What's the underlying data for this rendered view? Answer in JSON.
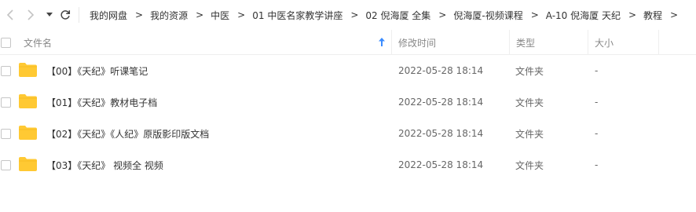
{
  "navigation": {
    "back_icon": "chevron-left-icon",
    "forward_icon": "chevron-right-icon",
    "dropdown_icon": "caret-down-icon",
    "refresh_icon": "refresh-icon"
  },
  "breadcrumb": {
    "separator": ">",
    "items": [
      "我的网盘",
      "我的资源",
      "中医",
      "01 中医名家教学讲座",
      "02 倪海厦 全集",
      "倪海厦-视频课程",
      "A-10 倪海厦 天纪",
      "教程"
    ]
  },
  "table": {
    "columns": {
      "name": "文件名",
      "modified": "修改时间",
      "type": "类型",
      "size": "大小"
    },
    "sort_icon": "sort-arrow-up-icon",
    "sort_color": "#3b8cff",
    "folder_color": "#ffc933",
    "rows": [
      {
        "name": "【00】《天纪》听课笔记",
        "modified": "2022-05-28 18:14",
        "type": "文件夹",
        "size": "-"
      },
      {
        "name": "【01】《天纪》教材电子档",
        "modified": "2022-05-28 18:14",
        "type": "文件夹",
        "size": "-"
      },
      {
        "name": "【02】《天纪》《人纪》原版影印版文档",
        "modified": "2022-05-28 18:14",
        "type": "文件夹",
        "size": "-"
      },
      {
        "name": "【03】《天纪》 视频全 视频",
        "modified": "2022-05-28 18:14",
        "type": "文件夹",
        "size": "-"
      }
    ]
  }
}
